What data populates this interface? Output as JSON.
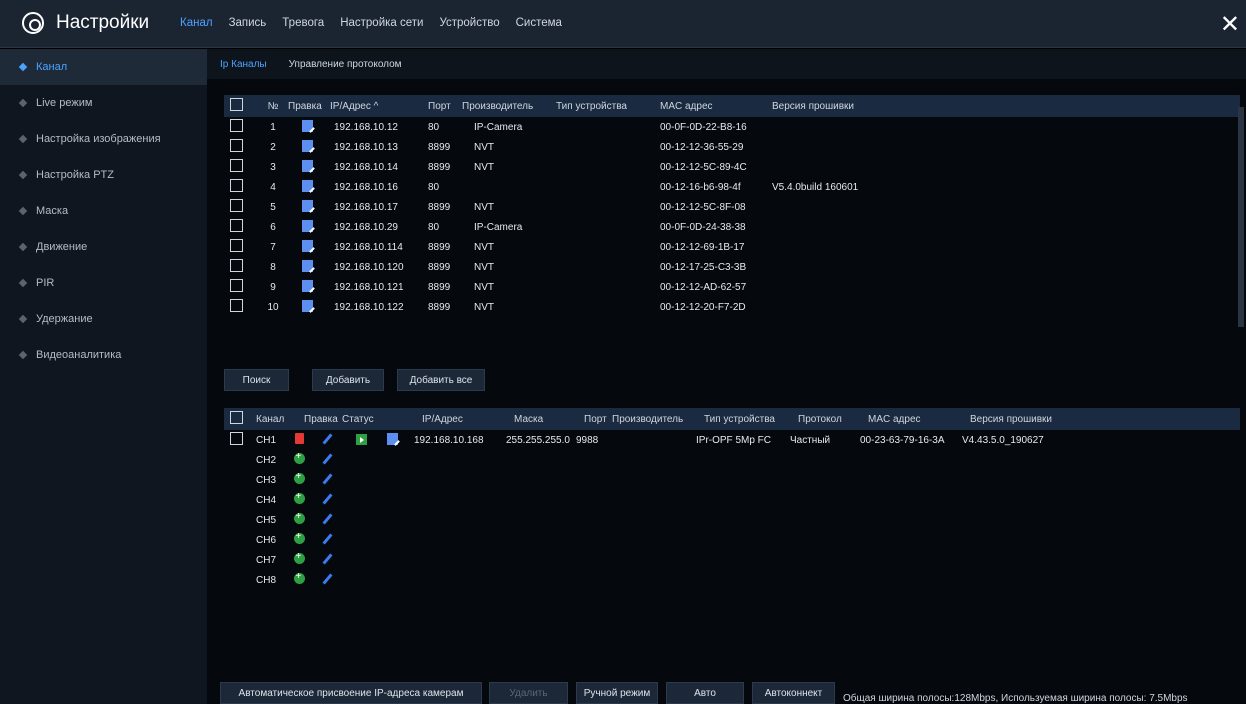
{
  "header": {
    "title": "Настройки",
    "tabs": [
      "Канал",
      "Запись",
      "Тревога",
      "Настройка сети",
      "Устройство",
      "Система"
    ],
    "active_tab": "Канал"
  },
  "sidebar": {
    "items": [
      "Канал",
      "Live режим",
      "Настройка изображения",
      "Настройка PTZ",
      "Маска",
      "Движение",
      "PIR",
      "Удержание",
      "Видеоаналитика"
    ],
    "active": "Канал"
  },
  "subtabs": [
    "Ip Каналы",
    "Управление протоколом"
  ],
  "search_table": {
    "headers": [
      "№",
      "Правка",
      "IP/Адрес ^",
      "Порт",
      "Производитель",
      "Тип устройства",
      "MAC адрес",
      "Версия прошивки"
    ],
    "rows": [
      {
        "n": "1",
        "ip": "192.168.10.12",
        "port": "80",
        "vendor": "IP-Camera",
        "type": "",
        "mac": "00-0F-0D-22-B8-16",
        "fw": ""
      },
      {
        "n": "2",
        "ip": "192.168.10.13",
        "port": "8899",
        "vendor": "NVT",
        "type": "",
        "mac": "00-12-12-36-55-29",
        "fw": ""
      },
      {
        "n": "3",
        "ip": "192.168.10.14",
        "port": "8899",
        "vendor": "NVT",
        "type": "",
        "mac": "00-12-12-5C-89-4C",
        "fw": ""
      },
      {
        "n": "4",
        "ip": "192.168.10.16",
        "port": "80",
        "vendor": "",
        "type": "",
        "mac": "00-12-16-b6-98-4f",
        "fw": "V5.4.0build 160601"
      },
      {
        "n": "5",
        "ip": "192.168.10.17",
        "port": "8899",
        "vendor": "NVT",
        "type": "",
        "mac": "00-12-12-5C-8F-08",
        "fw": ""
      },
      {
        "n": "6",
        "ip": "192.168.10.29",
        "port": "80",
        "vendor": "IP-Camera",
        "type": "",
        "mac": "00-0F-0D-24-38-38",
        "fw": ""
      },
      {
        "n": "7",
        "ip": "192.168.10.114",
        "port": "8899",
        "vendor": "NVT",
        "type": "",
        "mac": "00-12-12-69-1B-17",
        "fw": ""
      },
      {
        "n": "8",
        "ip": "192.168.10.120",
        "port": "8899",
        "vendor": "NVT",
        "type": "",
        "mac": "00-12-17-25-C3-3B",
        "fw": ""
      },
      {
        "n": "9",
        "ip": "192.168.10.121",
        "port": "8899",
        "vendor": "NVT",
        "type": "",
        "mac": "00-12-12-AD-62-57",
        "fw": ""
      },
      {
        "n": "10",
        "ip": "192.168.10.122",
        "port": "8899",
        "vendor": "NVT",
        "type": "",
        "mac": "00-12-12-20-F7-2D",
        "fw": ""
      }
    ]
  },
  "buttons_mid": [
    "Поиск",
    "Добавить",
    "Добавить все"
  ],
  "channel_table": {
    "headers": [
      "Канал",
      "Правка",
      "Статус",
      "IP/Адрес",
      "Маска",
      "Порт",
      "Производитель",
      "Тип устройства",
      "Протокол",
      "MAC адрес",
      "Версия прошивки"
    ],
    "rows": [
      {
        "ch": "CH1",
        "ip": "192.168.10.168",
        "mask": "255.255.255.0",
        "port": "9988",
        "vendor": "",
        "type": "IPr-OPF 5Mp FC",
        "proto": "Частный",
        "mac": "00-23-63-79-16-3A",
        "fw": "V4.43.5.0_190627",
        "configured": true
      },
      {
        "ch": "CH2",
        "configured": false
      },
      {
        "ch": "CH3",
        "configured": false
      },
      {
        "ch": "CH4",
        "configured": false
      },
      {
        "ch": "CH5",
        "configured": false
      },
      {
        "ch": "CH6",
        "configured": false
      },
      {
        "ch": "CH7",
        "configured": false
      },
      {
        "ch": "CH8",
        "configured": false
      }
    ]
  },
  "footer": {
    "auto_ip_btn": "Автоматическое присвоение IP-адреса камерам",
    "delete_btn": "Удалить",
    "manual_btn": "Ручной режим",
    "auto_btn": "Авто",
    "autoconnect_btn": "Автоконнект",
    "bandwidth": "Общая ширина полосы:128Mbps, Используемая ширина полосы: 7.5Mbps"
  },
  "colors": {
    "accent": "#4ca3ff",
    "header_row": "#1a2a40",
    "add": "#2ea043",
    "delete": "#e53935"
  },
  "icons": [
    "gear-icon",
    "close-icon",
    "edit-icon",
    "delete-icon",
    "add-icon",
    "pencil-icon",
    "play-icon"
  ]
}
